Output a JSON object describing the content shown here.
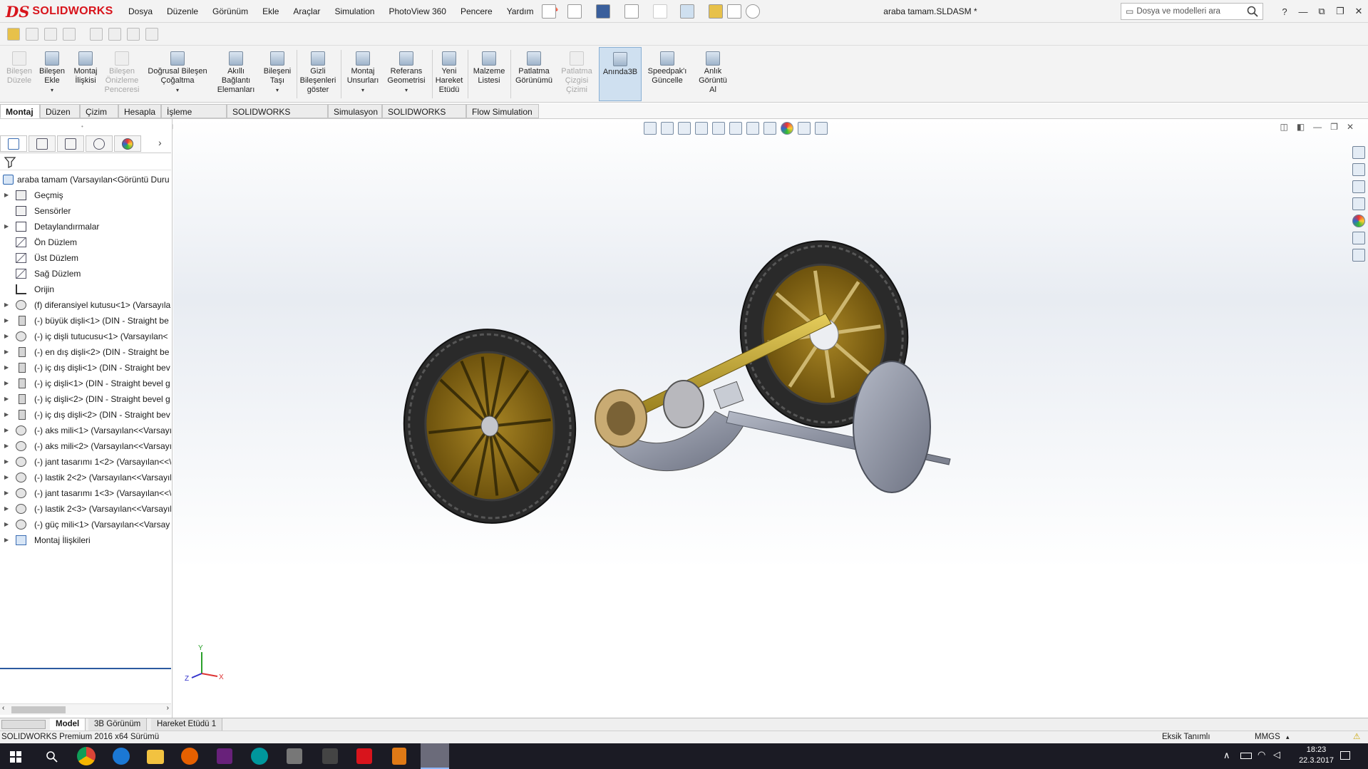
{
  "app": {
    "logo_ds": "DS",
    "logo_text": "SOLIDWORKS"
  },
  "menu": [
    "Dosya",
    "Düzenle",
    "Görünüm",
    "Ekle",
    "Araçlar",
    "Simulation",
    "PhotoView 360",
    "Pencere",
    "Yardım"
  ],
  "window": {
    "title": "araba tamam.SLDASM *"
  },
  "search": {
    "placeholder": "Dosya ve modelleri ara"
  },
  "window_controls": {
    "help": "?",
    "minimize": "—",
    "restore": "⧉",
    "maximize": "❐",
    "close": "✕"
  },
  "commands": [
    {
      "label": "Bileşen\nDüzele",
      "disabled": true
    },
    {
      "label": "Bileşen\nEkle",
      "disabled": false,
      "arrow": true
    },
    {
      "label": "Montaj\nİlişkisi",
      "disabled": false
    },
    {
      "label": "Bileşen\nÖnizleme\nPenceresi",
      "disabled": true
    },
    {
      "label": "Doğrusal Bileşen\nÇoğaltma",
      "disabled": false,
      "arrow": true
    },
    {
      "label": "Akıllı\nBağlantı\nElemanları",
      "disabled": false
    },
    {
      "label": "Bileşeni\nTaşı",
      "disabled": false,
      "arrow": true
    },
    {
      "label": "Gizli\nBileşenleri\ngöster",
      "disabled": false
    },
    {
      "label": "Montaj\nUnsurları",
      "disabled": false,
      "arrow": true
    },
    {
      "label": "Referans\nGeometrisi",
      "disabled": false,
      "arrow": true
    },
    {
      "label": "Yeni\nHareket\nEtüdü",
      "disabled": false
    },
    {
      "label": "Malzeme\nListesi",
      "disabled": false
    },
    {
      "label": "Patlatma\nGörünümü",
      "disabled": false
    },
    {
      "label": "Patlatma\nÇizgisi\nÇizimi",
      "disabled": true
    },
    {
      "label": "Anında3B",
      "disabled": false,
      "active": true
    },
    {
      "label": "Speedpak'ı\nGüncelle",
      "disabled": false
    },
    {
      "label": "Anlık\nGörüntü\nAl",
      "disabled": false
    }
  ],
  "tabs": [
    {
      "label": "Montaj",
      "active": true
    },
    {
      "label": "Düzen"
    },
    {
      "label": "Çizim"
    },
    {
      "label": "Hesapla"
    },
    {
      "label": "İşleme Araçları"
    },
    {
      "label": "SOLIDWORKS Eklentileri"
    },
    {
      "label": "Simulasyon"
    },
    {
      "label": "SOLIDWORKS MBD"
    },
    {
      "label": "Flow Simulation"
    }
  ],
  "tree": {
    "root": "araba tamam  (Varsayılan<Görüntü Duru",
    "items": [
      {
        "label": "Geçmiş",
        "expand": true,
        "icon": "history-icon"
      },
      {
        "label": "Sensörler",
        "expand": false,
        "icon": "sensor-icon"
      },
      {
        "label": "Detaylandırmalar",
        "expand": true,
        "icon": "annotation-icon"
      },
      {
        "label": "Ön Düzlem",
        "expand": false,
        "icon": "plane-icon"
      },
      {
        "label": "Üst Düzlem",
        "expand": false,
        "icon": "plane-icon"
      },
      {
        "label": "Sağ Düzlem",
        "expand": false,
        "icon": "plane-icon"
      },
      {
        "label": "Orijin",
        "expand": false,
        "icon": "origin-icon"
      },
      {
        "label": "(f) diferansiyel kutusu<1> (Varsayılan",
        "expand": true,
        "icon": "part-icon"
      },
      {
        "label": "(-) büyük dişli<1> (DIN - Straight be",
        "expand": true,
        "icon": "toolbox-part-icon"
      },
      {
        "label": "(-) iç dişli tutucusu<1> (Varsayılan<",
        "expand": true,
        "icon": "part-icon"
      },
      {
        "label": "(-) en dış dişli<2> (DIN - Straight be",
        "expand": true,
        "icon": "toolbox-part-icon"
      },
      {
        "label": "(-) iç dış dişli<1> (DIN - Straight bev",
        "expand": true,
        "icon": "toolbox-part-icon"
      },
      {
        "label": "(-) iç dişli<1> (DIN - Straight bevel g",
        "expand": true,
        "icon": "toolbox-part-icon"
      },
      {
        "label": "(-) iç dişli<2> (DIN - Straight bevel g",
        "expand": true,
        "icon": "toolbox-part-icon"
      },
      {
        "label": "(-) iç dış dişli<2> (DIN - Straight bev",
        "expand": true,
        "icon": "toolbox-part-icon"
      },
      {
        "label": "(-) aks mili<1> (Varsayılan<<Varsayı",
        "expand": true,
        "icon": "part-icon"
      },
      {
        "label": "(-) aks mili<2> (Varsayılan<<Varsayı",
        "expand": true,
        "icon": "part-icon"
      },
      {
        "label": "(-) jant tasarımı 1<2> (Varsayılan<<\\",
        "expand": true,
        "icon": "part-icon"
      },
      {
        "label": "(-) lastik 2<2> (Varsayılan<<Varsayıl",
        "expand": true,
        "icon": "part-icon"
      },
      {
        "label": "(-) jant tasarımı 1<3> (Varsayılan<<\\",
        "expand": true,
        "icon": "part-icon"
      },
      {
        "label": "(-) lastik 2<3> (Varsayılan<<Varsayıl",
        "expand": true,
        "icon": "part-icon"
      },
      {
        "label": "(-) güç mili<1> (Varsayılan<<Varsay",
        "expand": true,
        "icon": "part-icon"
      },
      {
        "label": "Montaj İlişkileri",
        "expand": true,
        "icon": "mates-icon"
      }
    ]
  },
  "triad": {
    "x": "X",
    "y": "Y",
    "z": "Z"
  },
  "bottom_tabs": [
    {
      "label": "Model",
      "active": true
    },
    {
      "label": "3B Görünüm"
    },
    {
      "label": "Hareket Etüdü 1"
    }
  ],
  "status": {
    "left": "SOLIDWORKS Premium 2016 x64 Sürümü",
    "state": "Eksik Tanımlı",
    "units": "MMGS"
  },
  "clock": {
    "time": "18:23",
    "date": "22.3.2017"
  },
  "colors": {
    "brand": "#d8141c",
    "rim": "#8a6a14",
    "tire": "#2e2e2e",
    "axle": "#b89a2a",
    "steel": "#8a8f9c"
  }
}
